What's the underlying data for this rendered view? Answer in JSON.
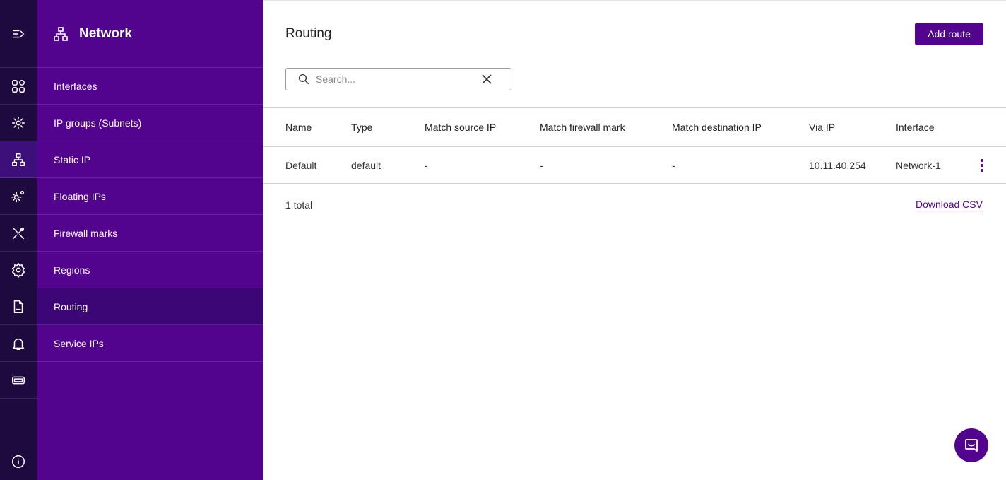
{
  "colors": {
    "rail": "#1f0a40",
    "sidebar": "#52048f",
    "sidebar_active": "#3d0676",
    "accent": "#52048f"
  },
  "rail": {
    "icons": [
      "expand-menu-icon",
      "apps-grid-icon",
      "cog-network-icon",
      "network-icon",
      "cogs-icon",
      "tools-icon",
      "settings-icon",
      "log-file-icon",
      "bell-icon",
      "ticket-icon",
      "info-icon"
    ]
  },
  "sidebar": {
    "title": "Network",
    "items": [
      {
        "label": "Interfaces"
      },
      {
        "label": "IP groups (Subnets)"
      },
      {
        "label": "Static IP"
      },
      {
        "label": "Floating IPs"
      },
      {
        "label": "Firewall marks"
      },
      {
        "label": "Regions"
      },
      {
        "label": "Routing"
      },
      {
        "label": "Service IPs"
      }
    ],
    "active": "Routing"
  },
  "main": {
    "title": "Routing",
    "add_button": "Add route",
    "search": {
      "placeholder": "Search...",
      "value": ""
    },
    "table": {
      "columns": [
        "Name",
        "Type",
        "Match source IP",
        "Match firewall mark",
        "Match destination IP",
        "Via IP",
        "Interface"
      ],
      "rows": [
        [
          "Default",
          "default",
          "-",
          "-",
          "-",
          "10.11.40.254",
          "Network-1"
        ]
      ]
    },
    "total": "1 total",
    "download": "Download CSV"
  },
  "chat": {
    "icon": "chat-bubble-icon"
  }
}
